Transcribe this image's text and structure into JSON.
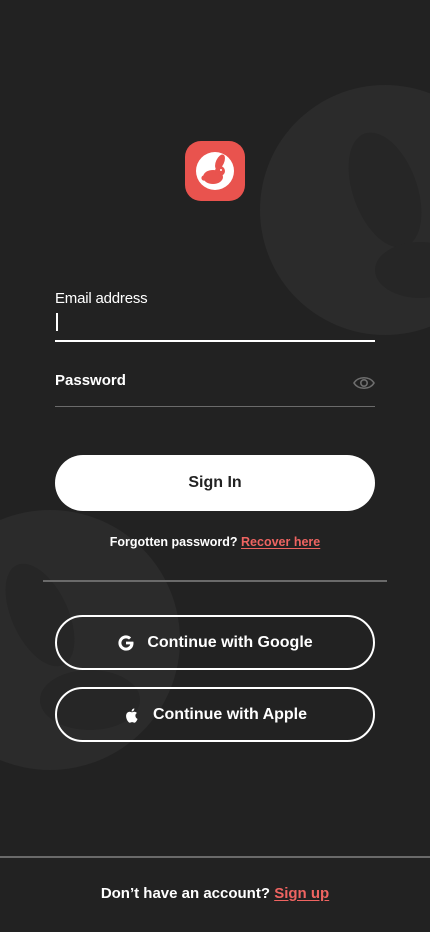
{
  "colors": {
    "background": "#222222",
    "accent": "#e9534e",
    "link": "#ef6461",
    "primary_button_bg": "#ffffff",
    "primary_button_text": "#222222",
    "divider": "#6a6a6a"
  },
  "logo": {
    "icon": "rabbit-icon"
  },
  "email": {
    "label": "Email address",
    "value": "",
    "placeholder": ""
  },
  "password": {
    "label": "Password",
    "value": "",
    "toggle_icon": "eye-icon"
  },
  "sign_in": {
    "label": "Sign In"
  },
  "forgot": {
    "text": "Forgotten password?",
    "link": "Recover here"
  },
  "social": {
    "google": {
      "label": "Continue with Google",
      "icon": "google-icon"
    },
    "apple": {
      "label": "Continue with Apple",
      "icon": "apple-icon"
    }
  },
  "footer": {
    "text": "Don’t have an account?",
    "link": "Sign up"
  }
}
